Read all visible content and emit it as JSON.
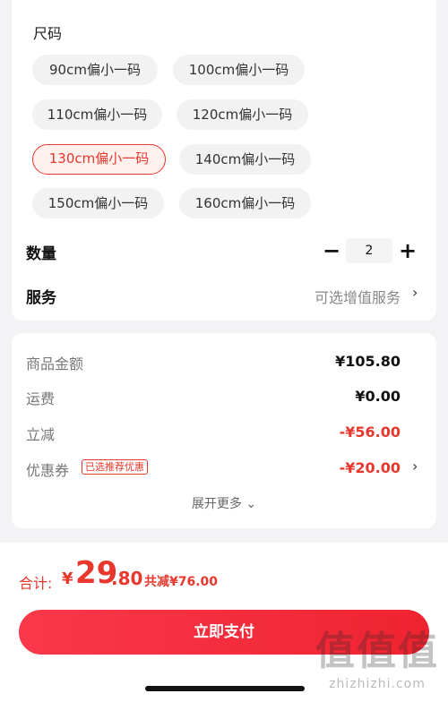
{
  "size_section": {
    "title": "尺码",
    "options": [
      {
        "label": "90cm偏小一码",
        "selected": false
      },
      {
        "label": "100cm偏小一码",
        "selected": false
      },
      {
        "label": "110cm偏小一码",
        "selected": false
      },
      {
        "label": "120cm偏小一码",
        "selected": false
      },
      {
        "label": "130cm偏小一码",
        "selected": true
      },
      {
        "label": "140cm偏小一码",
        "selected": false
      },
      {
        "label": "150cm偏小一码",
        "selected": false
      },
      {
        "label": "160cm偏小一码",
        "selected": false
      }
    ]
  },
  "quantity": {
    "label": "数量",
    "minus": "−",
    "value": "2",
    "plus": "+"
  },
  "service": {
    "label": "服务",
    "value": "可选增值服务",
    "chevron": "›"
  },
  "price_breakdown": {
    "goods_label": "商品金额",
    "goods_value": "¥105.80",
    "shipping_label": "运费",
    "shipping_value": "¥0.00",
    "instant_discount_label": "立减",
    "instant_discount_value": "-¥56.00",
    "coupon_label": "优惠券",
    "coupon_badge": "已选推荐优惠",
    "coupon_value": "-¥20.00",
    "coupon_chevron": "›",
    "expand_label": "展开更多 ⌄"
  },
  "footer": {
    "total_label": "合计:",
    "total_currency": "¥",
    "total_integer": "29",
    "total_decimal": ".80",
    "total_discount": "共减¥76.00",
    "pay_button": "立即支付"
  },
  "watermark": {
    "big": "值值值",
    "small": "zhizhizhi.com"
  },
  "colors": {
    "accent": "#e8372d",
    "background": "#f3f3f5"
  }
}
